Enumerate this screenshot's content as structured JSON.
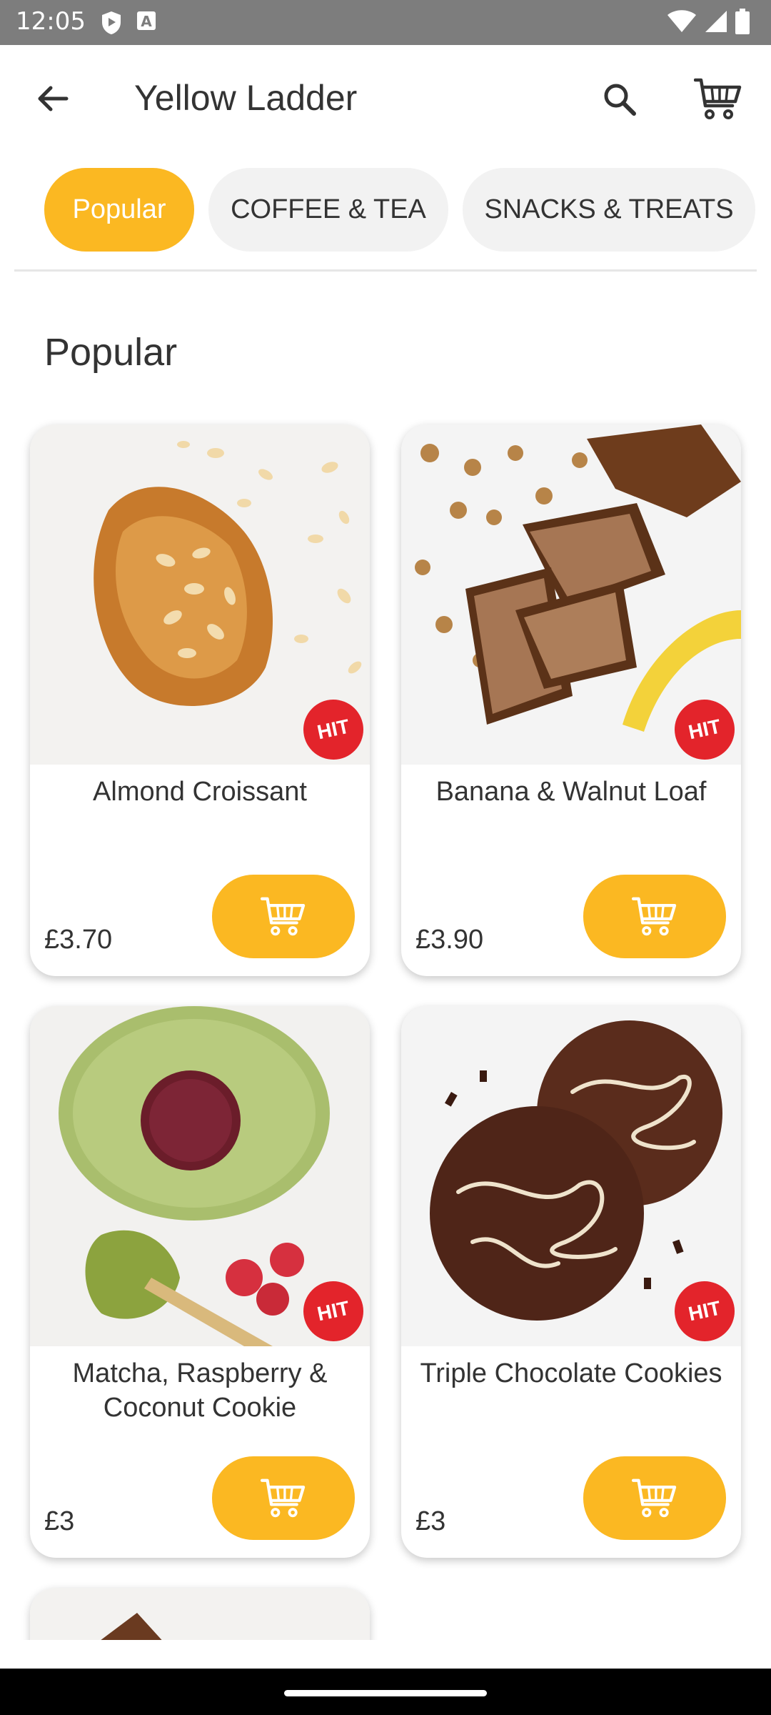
{
  "status_bar": {
    "time": "12:05"
  },
  "header": {
    "title": "Yellow Ladder"
  },
  "tabs": [
    {
      "label": "Popular",
      "active": true
    },
    {
      "label": "COFFEE & TEA",
      "active": false
    },
    {
      "label": "SNACKS & TREATS",
      "active": false
    }
  ],
  "section": {
    "title": "Popular"
  },
  "products": [
    {
      "name": "Almond Croissant",
      "price": "£3.70",
      "badge": "HIT"
    },
    {
      "name": "Banana & Walnut Loaf",
      "price": "£3.90",
      "badge": "HIT"
    },
    {
      "name": "Matcha, Raspberry & Coconut Cookie",
      "price": "£3",
      "badge": "HIT"
    },
    {
      "name": "Triple Chocolate Cookies",
      "price": "£3",
      "badge": "HIT"
    }
  ],
  "colors": {
    "accent": "#fbb822",
    "badge": "#e3242b",
    "status_bar": "#7d7d7d"
  },
  "icons": [
    "back-arrow-icon",
    "search-icon",
    "cart-icon",
    "add-to-cart-icon"
  ]
}
